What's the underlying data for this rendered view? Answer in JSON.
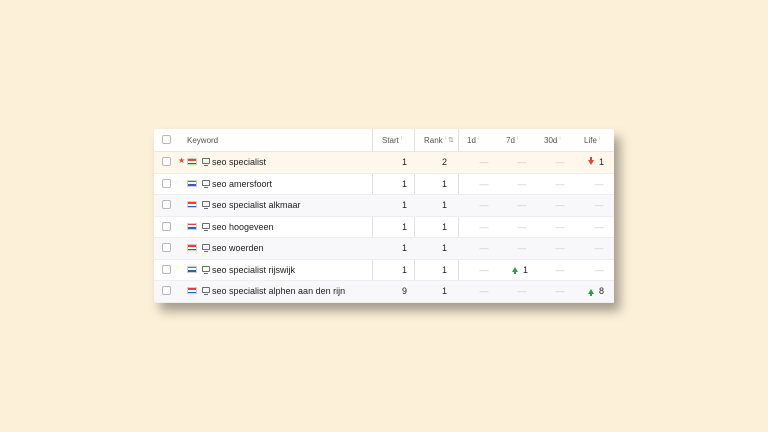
{
  "table": {
    "header": {
      "keyword": "Keyword",
      "start": "Start",
      "rank": "Rank",
      "d1": "1d",
      "d7": "7d",
      "d30": "30d",
      "life": "Life",
      "info_mark": "ⁱ",
      "sort_mark": "⇅"
    },
    "rows": [
      {
        "keyword": "seo specialist",
        "start": "1",
        "rank": "2",
        "d1": "—",
        "d7": "—",
        "d30": "—",
        "life": "1",
        "life_trend": "down",
        "starred": true,
        "country_flag": "NL"
      },
      {
        "keyword": "seo amersfoort",
        "start": "1",
        "rank": "1",
        "d1": "—",
        "d7": "—",
        "d30": "—",
        "life": "—",
        "starred": false,
        "country_flag": "NL"
      },
      {
        "keyword": "seo specialist alkmaar",
        "start": "1",
        "rank": "1",
        "d1": "—",
        "d7": "—",
        "d30": "—",
        "life": "—",
        "starred": false,
        "country_flag": "NL"
      },
      {
        "keyword": "seo hoogeveen",
        "start": "1",
        "rank": "1",
        "d1": "—",
        "d7": "—",
        "d30": "—",
        "life": "—",
        "starred": false,
        "country_flag": "NL"
      },
      {
        "keyword": "seo woerden",
        "start": "1",
        "rank": "1",
        "d1": "—",
        "d7": "—",
        "d30": "—",
        "life": "—",
        "starred": false,
        "country_flag": "NL"
      },
      {
        "keyword": "seo specialist rijswijk",
        "start": "1",
        "rank": "1",
        "d1": "—",
        "d7": "1",
        "d7_trend": "up",
        "d30": "—",
        "life": "—",
        "starred": false,
        "country_flag": "NL"
      },
      {
        "keyword": "seo specialist alphen aan den rijn",
        "start": "9",
        "rank": "1",
        "d1": "—",
        "d7": "—",
        "d30": "—",
        "life": "8",
        "life_trend": "up",
        "starred": false,
        "country_flag": "NL"
      }
    ]
  },
  "colors": {
    "background": "#fdf0d9",
    "up": "#2ea043",
    "down": "#e5433e",
    "star": "#e84a3c",
    "highlight_row": "#fff7ec"
  },
  "icons": {
    "device": "desktop-icon",
    "flag": "netherlands-flag-icon",
    "star": "star-icon",
    "up": "arrow-up-icon",
    "down": "arrow-down-icon"
  }
}
